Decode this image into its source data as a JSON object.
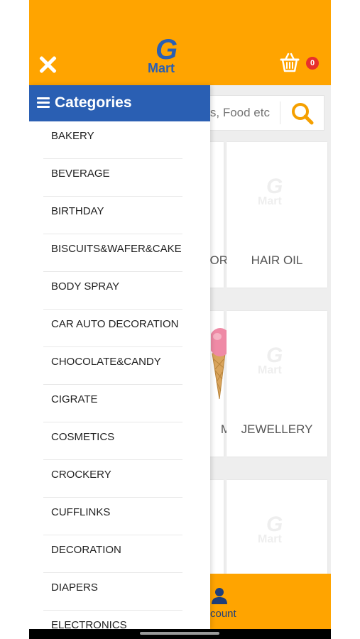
{
  "header": {
    "logo_letter": "G",
    "logo_text": "Mart",
    "cart_count": "0",
    "brand_color": "#ffa400",
    "accent_color": "#2a5fb3",
    "icons": [
      "close-icon",
      "cart-icon",
      "search-icon",
      "user-icon",
      "hamburger-icon"
    ]
  },
  "search": {
    "placeholder_visible": "s, Food etc"
  },
  "grid": {
    "row1_left_label": "OR",
    "row1_right_label": "HAIR OIL",
    "row2_left_label": "M",
    "row2_right_label": "JEWELLERY",
    "watermark_letter": "G",
    "watermark_text": "Mart"
  },
  "bottom": {
    "account_label": "count"
  },
  "drawer": {
    "title": "Categories",
    "items": [
      "BAKERY",
      "BEVERAGE",
      "BIRTHDAY",
      "BISCUITS&WAFER&CAKE",
      "BODY SPRAY",
      "CAR AUTO DECORATION",
      "CHOCOLATE&CANDY",
      "CIGRATE",
      "COSMETICS",
      "CROCKERY",
      "CUFFLINKS",
      "DECORATION",
      "DIAPERS",
      "ELECTRONICS"
    ]
  }
}
